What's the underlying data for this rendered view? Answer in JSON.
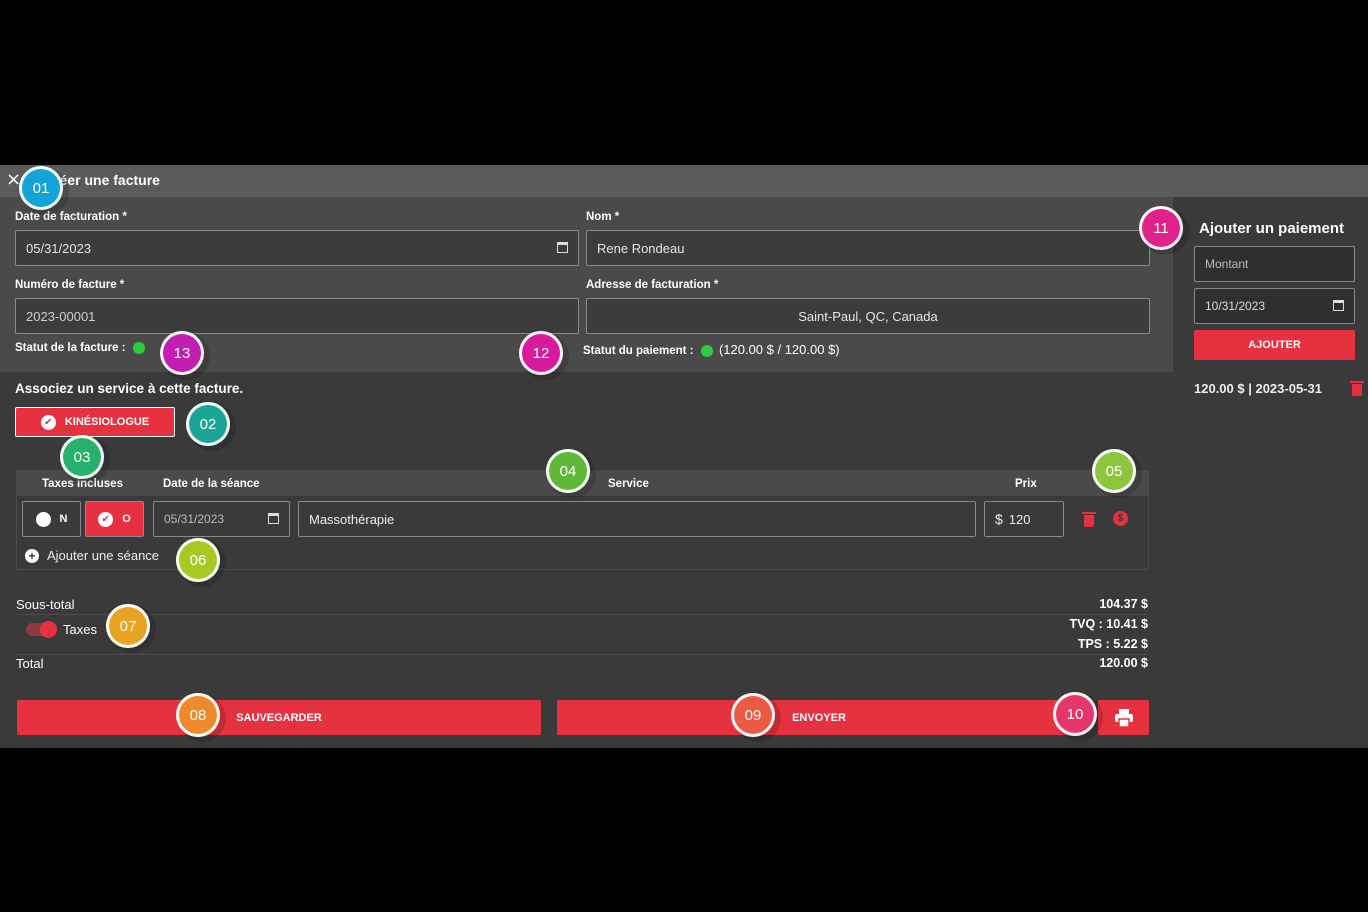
{
  "titlebar": {
    "close_icon": "×",
    "title": "Créer une facture"
  },
  "form": {
    "billing_date_label": "Date de facturation *",
    "billing_date_value": "05/31/2023",
    "name_label": "Nom *",
    "name_value": "Rene Rondeau",
    "invoice_number_label": "Numéro de facture *",
    "invoice_number_value": "2023-00001",
    "address_label": "Adresse de facturation *",
    "address_value": "Saint-Paul, QC, Canada",
    "invoice_status_label": "Statut de la facture :",
    "payment_status_label": "Statut du paiement :",
    "payment_status_value": "(120.00 $ / 120.00 $)",
    "status_color": "#2ecc40"
  },
  "payment": {
    "title": "Ajouter un paiement",
    "amount_placeholder": "Montant",
    "date_value": "10/31/2023",
    "add_button": "AJOUTER",
    "entry": "120.00 $ | 2023-05-31"
  },
  "services": {
    "title": "Associez un service à cette facture.",
    "service_button": "KINÉSIOLOGUE",
    "headers": {
      "taxes": "Taxes incluses",
      "date": "Date de la séance",
      "service": "Service",
      "price": "Prix"
    },
    "row": {
      "tax_no": "N",
      "tax_yes": "O",
      "date": "05/31/2023",
      "service": "Massothérapie",
      "currency": "$",
      "price": "120"
    },
    "add_session": "Ajouter une séance"
  },
  "totals": {
    "subtotal_label": "Sous-total",
    "subtotal_value": "104.37 $",
    "taxes_label": "Taxes",
    "tvq": "TVQ : 10.41 $",
    "tps": "TPS : 5.22 $",
    "total_label": "Total",
    "total_value": "120.00 $"
  },
  "actions": {
    "save": "SAUVEGARDER",
    "send": "ENVOYER"
  },
  "badges": [
    "01",
    "02",
    "03",
    "04",
    "05",
    "06",
    "07",
    "08",
    "09",
    "10",
    "11",
    "12",
    "13"
  ],
  "colors": {
    "accent": "#e63240",
    "panel": "#4a4a4a",
    "background": "#3a3a3a"
  }
}
